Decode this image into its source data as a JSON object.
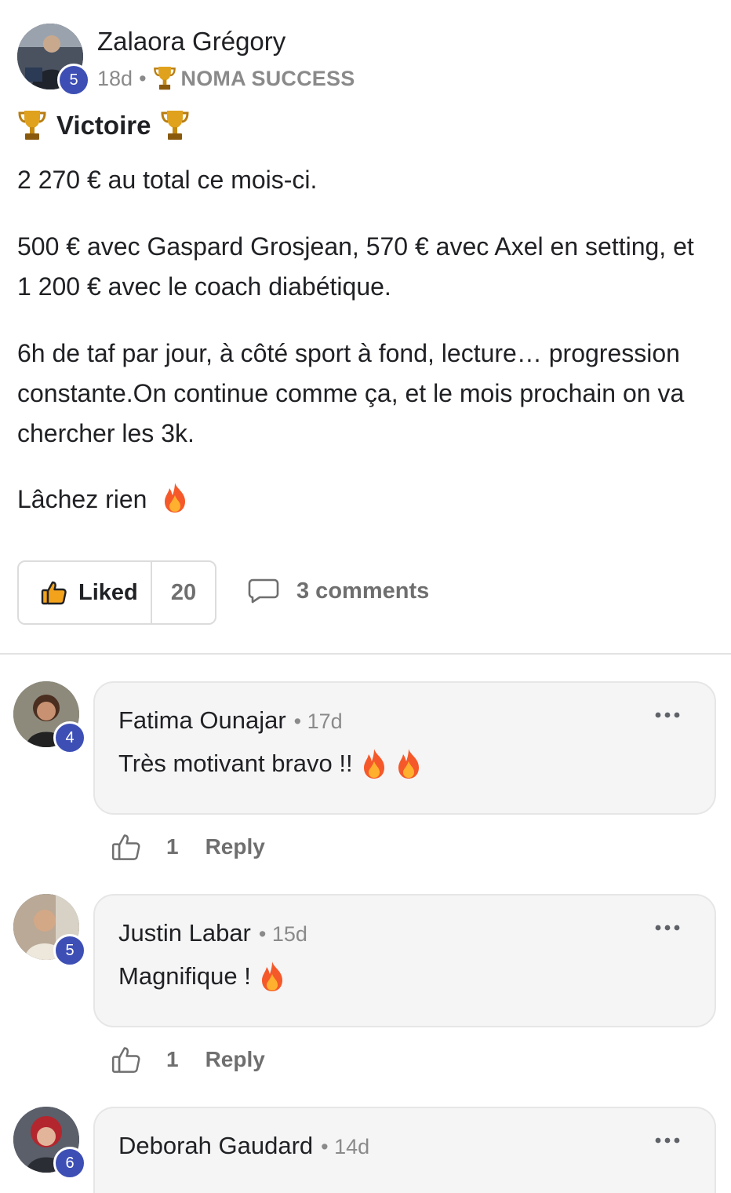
{
  "post": {
    "author": {
      "name": "Zalaora Grégory",
      "level": "5",
      "avatar": "author-avatar-photo"
    },
    "time": "18d",
    "category_icon": "trophy-icon",
    "category": "NOMA SUCCESS",
    "title": "Victoire",
    "paragraphs": {
      "p1": "2 270 € au total ce mois-ci.",
      "p2": "500 € avec Gaspard Grosjean, 570 € avec Axel en setting, et 1 200 € avec le coach diabétique.",
      "p3": "6h de taf par jour, à côté sport à fond, lecture… progression constante.On continue comme ça, et le mois prochain on va chercher les 3k.",
      "p4": "Lâchez rien"
    },
    "like_label": "Liked",
    "like_count": "20",
    "comments_label": "3 comments"
  },
  "comments": [
    {
      "name": "Fatima Ounajar",
      "time": "• 17d",
      "level": "4",
      "text": "Très motivant bravo !!",
      "likes": "1",
      "reply": "Reply"
    },
    {
      "name": "Justin Labar",
      "time": "• 15d",
      "level": "5",
      "text": "Magnifique !",
      "likes": "1",
      "reply": "Reply"
    },
    {
      "name": "Deborah Gaudard",
      "time": "• 14d",
      "level": "6"
    }
  ],
  "colors": {
    "accent": "#3d4fb5",
    "muted": "#8a8a8a",
    "bubble": "#f5f5f6"
  }
}
